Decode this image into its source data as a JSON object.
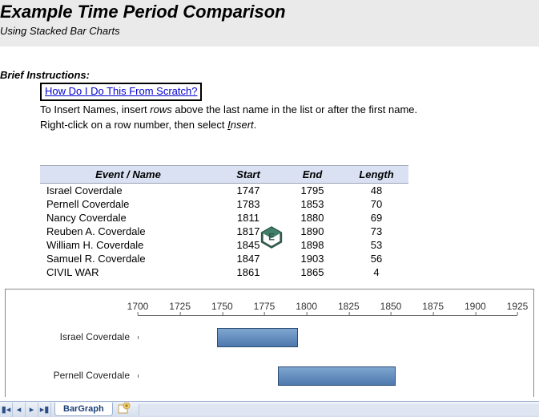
{
  "header": {
    "title": "Example Time Period Comparison",
    "subtitle": "Using Stacked Bar Charts"
  },
  "brief_label": "Brief Instructions:",
  "link_text": "How Do I Do This From Scratch?",
  "instr_line1_a": "To Insert Names, insert ",
  "instr_line1_i": "rows",
  "instr_line1_b": " above the last name in the list or after the first name.",
  "instr_line2_a": "Right-click on a row number, then select ",
  "instr_line2_iu": "I",
  "instr_line2_i": "nsert",
  "instr_line2_b": ".",
  "table": {
    "headers": {
      "name": "Event / Name",
      "start": "Start",
      "end": "End",
      "length": "Length"
    },
    "rows": [
      {
        "name": "Israel Coverdale",
        "start": 1747,
        "end": 1795,
        "length": 48
      },
      {
        "name": "Pernell Coverdale",
        "start": 1783,
        "end": 1853,
        "length": 70
      },
      {
        "name": "Nancy Coverdale",
        "start": 1811,
        "end": 1880,
        "length": 69
      },
      {
        "name": "Reuben A. Coverdale",
        "start": 1817,
        "end": 1890,
        "length": 73
      },
      {
        "name": "William H. Coverdale",
        "start": 1845,
        "end": 1898,
        "length": 53
      },
      {
        "name": "Samuel R. Coverdale",
        "start": 1847,
        "end": 1903,
        "length": 56
      },
      {
        "name": "CIVIL WAR",
        "start": 1861,
        "end": 1865,
        "length": 4
      }
    ]
  },
  "chart_data": {
    "type": "bar",
    "orientation": "horizontal",
    "xlim": [
      1700,
      1925
    ],
    "ticks": [
      1700,
      1725,
      1750,
      1775,
      1800,
      1825,
      1850,
      1875,
      1900,
      1925
    ],
    "series": [
      {
        "name": "Israel Coverdale",
        "start": 1747,
        "end": 1795
      },
      {
        "name": "Pernell Coverdale",
        "start": 1783,
        "end": 1853
      }
    ],
    "bar_color": "#5b86b8"
  },
  "tabs": {
    "active": "BarGraph"
  }
}
